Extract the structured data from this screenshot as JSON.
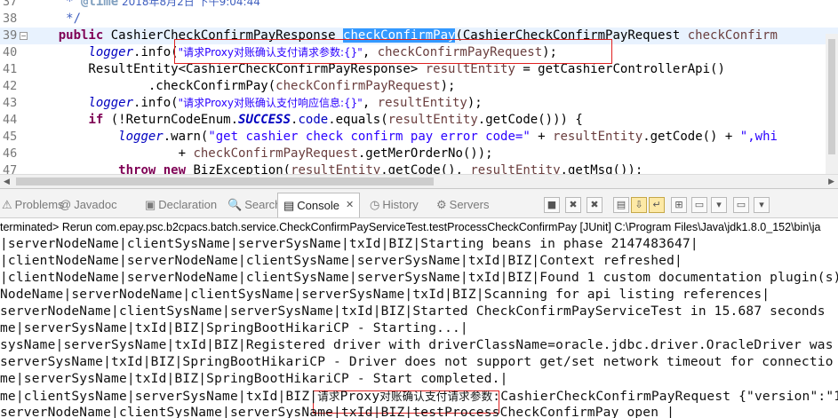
{
  "editor": {
    "lines": [
      {
        "num": "37",
        "fold": "",
        "segs": [
          {
            "t": "     * ",
            "c": "com"
          },
          {
            "t": "@time",
            "c": "tag"
          },
          {
            "t": " 2018年8月2日 下午9:04:44",
            "c": "com"
          }
        ]
      },
      {
        "num": "38",
        "fold": "",
        "segs": [
          {
            "t": "     */",
            "c": "com"
          }
        ]
      },
      {
        "num": "39",
        "fold": "−",
        "current": true,
        "segs": [
          {
            "t": "    "
          },
          {
            "t": "public",
            "c": "kw"
          },
          {
            "t": " CashierCheckConfirmPayResponse "
          },
          {
            "t": "checkConfirmPay",
            "c": "sel"
          },
          {
            "t": "(CashierCheckConfirmPayRequest "
          },
          {
            "t": "checkConfirm",
            "c": "var"
          }
        ]
      },
      {
        "num": "40",
        "fold": "",
        "segs": [
          {
            "t": "        "
          },
          {
            "t": "logger",
            "c": "fld-i"
          },
          {
            "t": ".info("
          },
          {
            "t": "\"请求Proxy对账确认支付请求参数:{}\"",
            "c": "str"
          },
          {
            "t": ", "
          },
          {
            "t": "checkConfirmPayRequest",
            "c": "var"
          },
          {
            "t": ");"
          }
        ]
      },
      {
        "num": "41",
        "fold": "",
        "segs": [
          {
            "t": "        ResultEntity<CashierCheckConfirmPayResponse> "
          },
          {
            "t": "resultEntity",
            "c": "var"
          },
          {
            "t": " = getCashierControllerApi()"
          }
        ]
      },
      {
        "num": "42",
        "fold": "",
        "segs": [
          {
            "t": "                .checkConfirmPay("
          },
          {
            "t": "checkConfirmPayRequest",
            "c": "var"
          },
          {
            "t": ");"
          }
        ]
      },
      {
        "num": "43",
        "fold": "",
        "segs": [
          {
            "t": "        "
          },
          {
            "t": "logger",
            "c": "fld-i"
          },
          {
            "t": ".info("
          },
          {
            "t": "\"请求Proxy对账确认支付响应信息:{}\"",
            "c": "str"
          },
          {
            "t": ", "
          },
          {
            "t": "resultEntity",
            "c": "var"
          },
          {
            "t": ");"
          }
        ]
      },
      {
        "num": "44",
        "fold": "",
        "segs": [
          {
            "t": "        "
          },
          {
            "t": "if",
            "c": "kw"
          },
          {
            "t": " (!ReturnCodeEnum."
          },
          {
            "t": "SUCCESS",
            "c": "fld-bi"
          },
          {
            "t": "."
          },
          {
            "t": "code",
            "c": "fld"
          },
          {
            "t": ".equals("
          },
          {
            "t": "resultEntity",
            "c": "var"
          },
          {
            "t": ".getCode())) {"
          }
        ]
      },
      {
        "num": "45",
        "fold": "",
        "segs": [
          {
            "t": "            "
          },
          {
            "t": "logger",
            "c": "fld-i"
          },
          {
            "t": ".warn("
          },
          {
            "t": "\"get cashier check confirm pay error code=\"",
            "c": "str"
          },
          {
            "t": " + "
          },
          {
            "t": "resultEntity",
            "c": "var"
          },
          {
            "t": ".getCode() + "
          },
          {
            "t": "\",whi",
            "c": "str"
          }
        ]
      },
      {
        "num": "46",
        "fold": "",
        "segs": [
          {
            "t": "                    + "
          },
          {
            "t": "checkConfirmPayRequest",
            "c": "var"
          },
          {
            "t": ".getMerOrderNo());"
          }
        ]
      },
      {
        "num": "47",
        "fold": "",
        "segs": [
          {
            "t": "            "
          },
          {
            "t": "throw",
            "c": "kw"
          },
          {
            "t": " "
          },
          {
            "t": "new",
            "c": "kw"
          },
          {
            "t": " BizException("
          },
          {
            "t": "resultEntity",
            "c": "var"
          },
          {
            "t": ".getCode(), "
          },
          {
            "t": "resultEntity",
            "c": "var"
          },
          {
            "t": ".getMsg());"
          }
        ]
      }
    ]
  },
  "tabs": [
    {
      "label": "Problems",
      "icon": "problems-icon",
      "glyph": "⚠",
      "active": false
    },
    {
      "label": "Javadoc",
      "icon": "javadoc-icon",
      "glyph": "@",
      "active": false
    },
    {
      "label": "Declaration",
      "icon": "declaration-icon",
      "glyph": "▣",
      "active": false
    },
    {
      "label": "Search",
      "icon": "search-icon",
      "glyph": "🔍",
      "active": false
    },
    {
      "label": "Console",
      "icon": "console-icon",
      "glyph": "▤",
      "active": true
    },
    {
      "label": "History",
      "icon": "history-icon",
      "glyph": "◷",
      "active": false
    },
    {
      "label": "Servers",
      "icon": "servers-icon",
      "glyph": "⚙",
      "active": false
    }
  ],
  "toolbar": [
    {
      "icon": "stop-icon",
      "glyph": "■"
    },
    {
      "icon": "remove-launch-icon",
      "glyph": "✖"
    },
    {
      "icon": "remove-all-icon",
      "glyph": "✖"
    },
    {
      "icon": "clear-console-icon",
      "glyph": "▤"
    },
    {
      "icon": "scroll-lock-icon",
      "glyph": "⇩"
    },
    {
      "icon": "word-wrap-icon",
      "glyph": "↵"
    },
    {
      "icon": "pin-console-icon",
      "glyph": "⊞"
    },
    {
      "icon": "show-on-output-icon",
      "glyph": "▭"
    },
    {
      "icon": "display-console-icon",
      "glyph": "▾"
    },
    {
      "icon": "open-console-icon",
      "glyph": "▭"
    },
    {
      "icon": "open-console-menu-icon",
      "glyph": "▾"
    }
  ],
  "status": "terminated> Rerun com.epay.psc.b2cpacs.batch.service.CheckConfirmPayServiceTest.testProcessCheckConfirmPay [JUnit] C:\\Program Files\\Java\\jdk1.8.0_152\\bin\\ja",
  "console": [
    "|serverNodeName|clientSysName|serverSysName|txId|BIZ|Starting beans in phase 2147483647|",
    "|clientNodeName|serverNodeName|clientSysName|serverSysName|txId|BIZ|Context refreshed|",
    "|clientNodeName|serverNodeName|clientSysName|serverSysName|txId|BIZ|Found 1 custom documentation plugin(s)",
    "NodeName|serverNodeName|clientSysName|serverSysName|txId|BIZ|Scanning for api listing references|",
    "serverNodeName|clientSysName|serverSysName|txId|BIZ|Started CheckConfirmPayServiceTest in 15.687 seconds",
    "me|serverSysName|txId|BIZ|SpringBootHikariCP - Starting...|",
    "sysName|serverSysName|txId|BIZ|Registered driver with driverClassName=oracle.jdbc.driver.OracleDriver was",
    "serverSysName|txId|BIZ|SpringBootHikariCP - Driver does not support get/set network timeout for connectio",
    "me|serverSysName|txId|BIZ|SpringBootHikariCP - Start completed.|",
    "me|clientSysName|serverSysName|txId|BIZ|请求Proxy对账确认支付请求参数:CashierCheckConfirmPayRequest {\"version\":\"1",
    "serverNodeName|clientSysName|serverSysName|txId|BIZ|testProcessCheckConfirmPay open |"
  ]
}
